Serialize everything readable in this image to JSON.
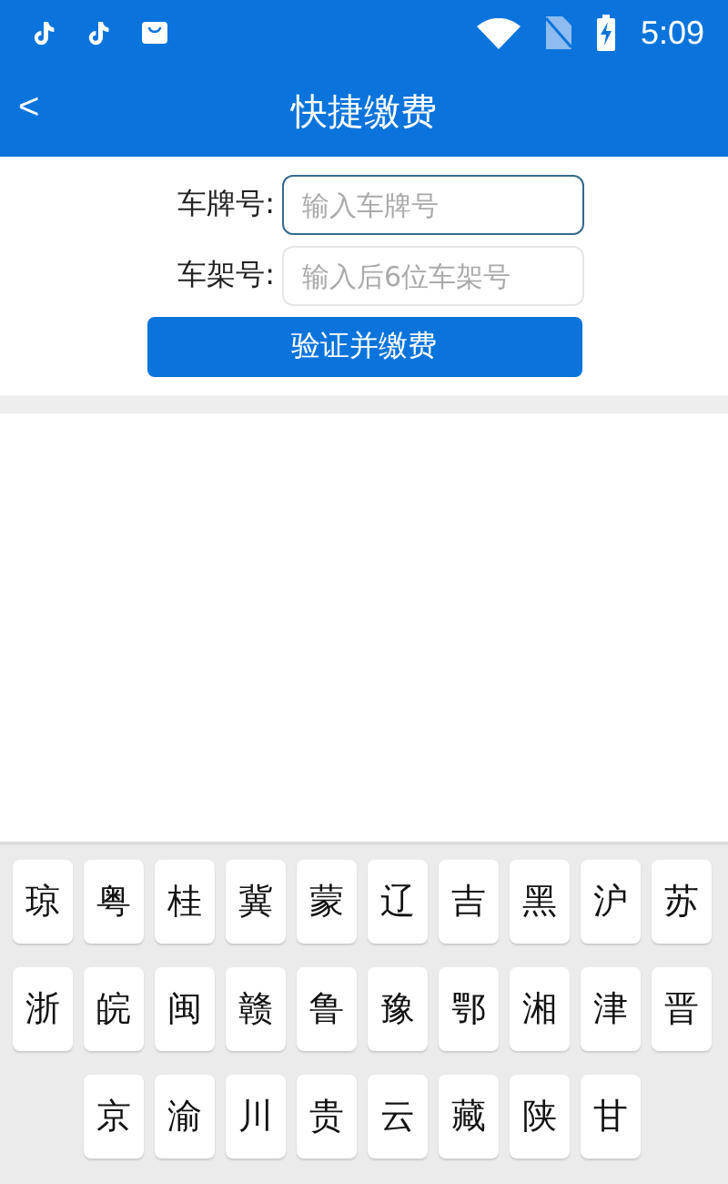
{
  "status_bar": {
    "time": "5:09"
  },
  "header": {
    "back": "<",
    "title": "快捷缴费"
  },
  "form": {
    "fields": [
      {
        "label": "车牌号:",
        "placeholder": "输入车牌号",
        "focused": true
      },
      {
        "label": "车架号:",
        "placeholder": "输入后6位车架号",
        "focused": false
      }
    ],
    "submit": "验证并缴费"
  },
  "keyboard": {
    "rows": [
      [
        "琼",
        "粤",
        "桂",
        "冀",
        "蒙",
        "辽",
        "吉",
        "黑",
        "沪",
        "苏"
      ],
      [
        "浙",
        "皖",
        "闽",
        "赣",
        "鲁",
        "豫",
        "鄂",
        "湘",
        "津",
        "晋"
      ],
      [
        "",
        "京",
        "渝",
        "川",
        "贵",
        "云",
        "藏",
        "陕",
        "甘"
      ]
    ]
  }
}
